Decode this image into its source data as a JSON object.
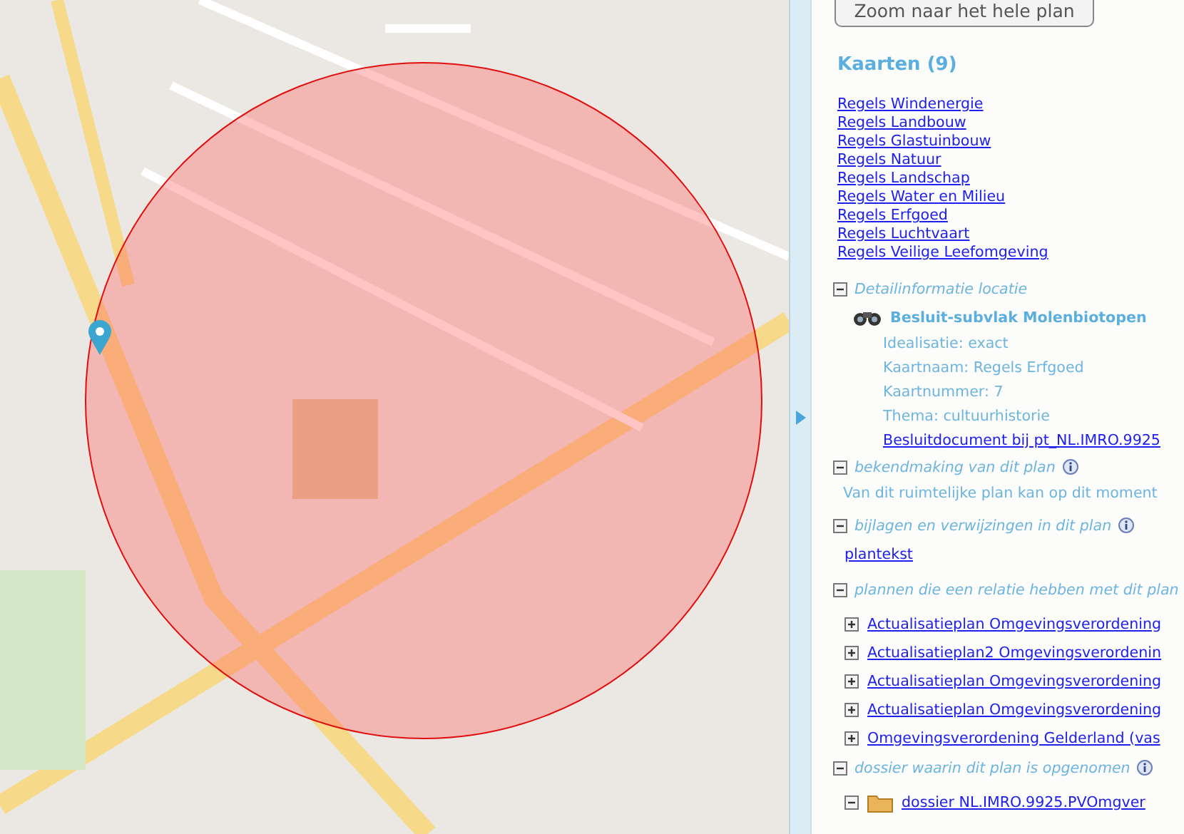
{
  "zoom_button": "Zoom naar het hele plan",
  "maps": {
    "title": "Kaarten (9)",
    "links": [
      "Regels Windenergie",
      "Regels Landbouw",
      "Regels Glastuinbouw",
      "Regels Natuur",
      "Regels Landschap",
      "Regels Water en Milieu",
      "Regels Erfgoed",
      "Regels Luchtvaart",
      "Regels Veilige Leefomgeving"
    ]
  },
  "sections": [
    {
      "kind": "detail",
      "title": "Detailinformatie locatie",
      "expanded": true,
      "info": false,
      "heading": "Besluit-subvlak Molenbiotopen",
      "lines": [
        "Idealisatie: exact",
        "Kaartnaam: Regels Erfgoed",
        "Kaartnummer: 7",
        "Thema: cultuurhistorie"
      ],
      "link": "Besluitdocument bij pt_NL.IMRO.9925"
    },
    {
      "kind": "text",
      "title": "bekendmaking van dit plan",
      "expanded": true,
      "info": true,
      "text": "Van dit ruimtelijke plan kan op dit moment"
    },
    {
      "kind": "links",
      "title": "bijlagen en verwijzingen in dit plan",
      "expanded": true,
      "info": true,
      "links": [
        "plantekst"
      ]
    },
    {
      "kind": "tree",
      "title": "plannen die een relatie hebben met dit plan",
      "expanded": true,
      "info": false,
      "items": [
        {
          "label": "Actualisatieplan Omgevingsverordening",
          "expanded": false,
          "folder": false
        },
        {
          "label": "Actualisatieplan2 Omgevingsverordenin",
          "expanded": false,
          "folder": false
        },
        {
          "label": "Actualisatieplan Omgevingsverordening",
          "expanded": false,
          "folder": false
        },
        {
          "label": "Actualisatieplan Omgevingsverordening",
          "expanded": false,
          "folder": false
        },
        {
          "label": "Omgevingsverordening Gelderland (vas",
          "expanded": false,
          "folder": false
        }
      ]
    },
    {
      "kind": "tree",
      "title": "dossier waarin dit plan is opgenomen",
      "expanded": true,
      "info": true,
      "items": [
        {
          "label": "dossier NL.IMRO.9925.PVOmgver",
          "expanded": true,
          "folder": true
        }
      ]
    }
  ]
}
